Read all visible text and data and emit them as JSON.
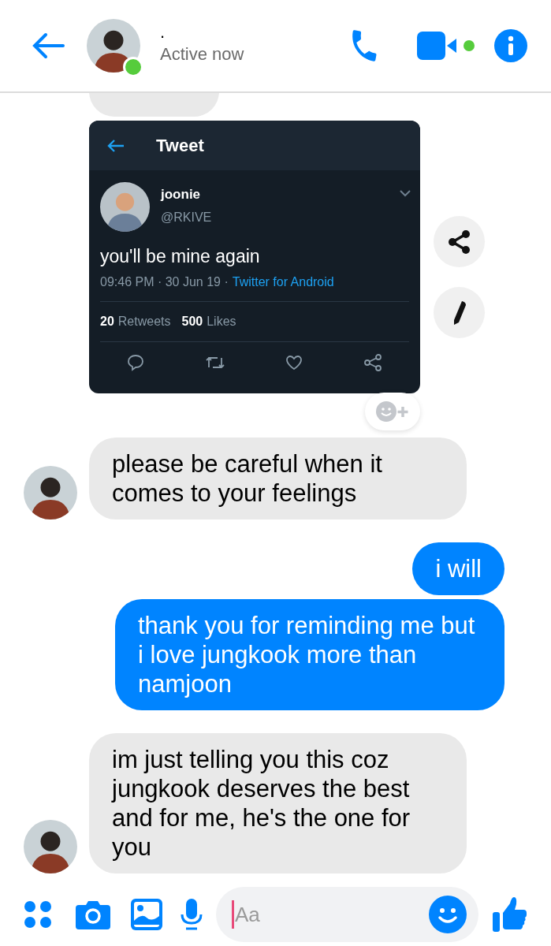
{
  "header": {
    "name": ".",
    "status": "Active now",
    "online": true
  },
  "messages": [
    {
      "kind": "cut_off"
    },
    {
      "kind": "tweet",
      "tweet": {
        "title": "Tweet",
        "author": "joonie",
        "handle": "@RKIVE",
        "text": "you'll be mine again",
        "time": "09:46 PM · 30 Jun 19 ·",
        "source": "Twitter for Android",
        "retweets": "20",
        "retweets_label": "Retweets",
        "likes": "500",
        "likes_label": "Likes"
      }
    },
    {
      "kind": "received",
      "text": "please be careful when it comes to your feelings",
      "avatar": true
    },
    {
      "kind": "sent",
      "text": "i will"
    },
    {
      "kind": "sent",
      "text": "thank you for reminding me but i love jungkook more than namjoon"
    },
    {
      "kind": "received",
      "text": "im just telling you this coz jungkook deserves the best and for me, he's the one for you",
      "avatar": true
    }
  ],
  "composer": {
    "placeholder": "Aa"
  }
}
